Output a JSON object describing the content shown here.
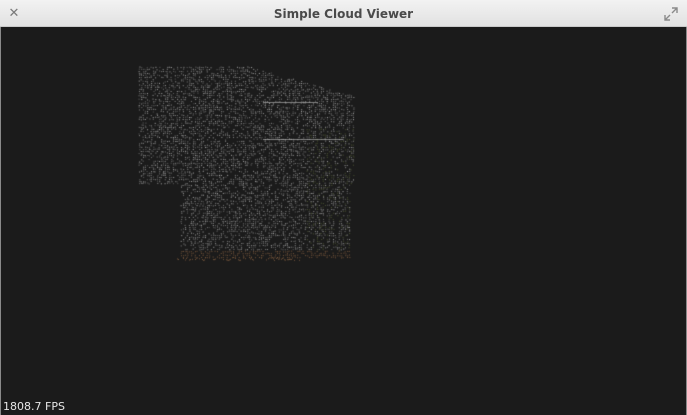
{
  "window": {
    "title": "Simple Cloud Viewer",
    "close_icon": "close-icon",
    "maximize_icon": "maximize-icon"
  },
  "viewer": {
    "fps_label": "1808.7 FPS",
    "background_color": "#1b1b1b",
    "point_color_main": "#c8c8c8",
    "point_color_floor": "#a0704a",
    "point_color_plant": "#6f7d45"
  }
}
